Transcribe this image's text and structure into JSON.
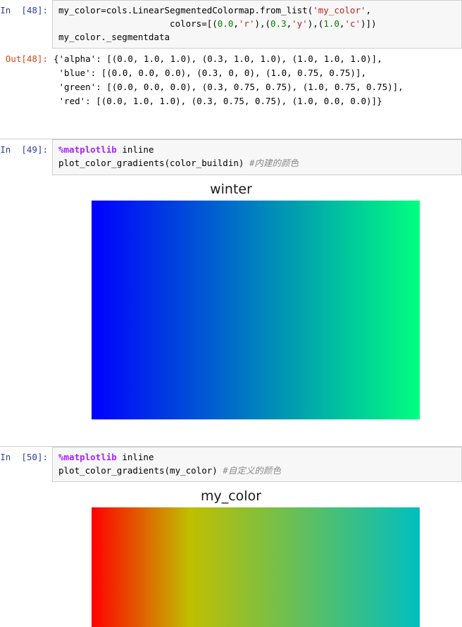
{
  "notebook": {
    "cells": [
      {
        "type": "code-input",
        "prompt": "In  [48]:",
        "lines": [
          [
            {
              "t": "plain",
              "v": "my_color=cols.LinearSegmentedColormap.from_list("
            },
            {
              "t": "str",
              "v": "'my_color'"
            },
            {
              "t": "plain",
              "v": ","
            }
          ],
          [
            {
              "t": "plain",
              "v": "                     colors=[("
            },
            {
              "t": "num",
              "v": "0.0"
            },
            {
              "t": "plain",
              "v": ","
            },
            {
              "t": "str",
              "v": "'r'"
            },
            {
              "t": "plain",
              "v": "),("
            },
            {
              "t": "num",
              "v": "0.3"
            },
            {
              "t": "plain",
              "v": ","
            },
            {
              "t": "str",
              "v": "'y'"
            },
            {
              "t": "plain",
              "v": "),("
            },
            {
              "t": "num",
              "v": "1.0"
            },
            {
              "t": "plain",
              "v": ","
            },
            {
              "t": "str",
              "v": "'c'"
            },
            {
              "t": "plain",
              "v": ")])"
            }
          ],
          [
            {
              "t": "plain",
              "v": "my_color._segmentdata"
            }
          ]
        ]
      },
      {
        "type": "text-output",
        "prompt": "Out[48]:",
        "lines": [
          "{'alpha': [(0.0, 1.0, 1.0), (0.3, 1.0, 1.0), (1.0, 1.0, 1.0)],",
          " 'blue': [(0.0, 0.0, 0.0), (0.3, 0, 0), (1.0, 0.75, 0.75)],",
          " 'green': [(0.0, 0.0, 0.0), (0.3, 0.75, 0.75), (1.0, 0.75, 0.75)],",
          " 'red': [(0.0, 1.0, 1.0), (0.3, 0.75, 0.75), (1.0, 0.0, 0.0)]}"
        ]
      },
      {
        "type": "code-input",
        "prompt": "In  [49]:",
        "lines": [
          [
            {
              "t": "magic",
              "v": "%matplotlib"
            },
            {
              "t": "plain",
              "v": " inline"
            }
          ],
          [
            {
              "t": "plain",
              "v": "plot_color_gradients(color_buildin) "
            },
            {
              "t": "cmt",
              "v": "#内建的颜色"
            }
          ]
        ]
      },
      {
        "type": "figure",
        "title": "winter",
        "size": "tall"
      },
      {
        "type": "code-input",
        "prompt": "In  [50]:",
        "lines": [
          [
            {
              "t": "magic",
              "v": "%matplotlib"
            },
            {
              "t": "plain",
              "v": " inline"
            }
          ],
          [
            {
              "t": "plain",
              "v": "plot_color_gradients(my_color) "
            },
            {
              "t": "cmt",
              "v": "#自定义的颜色"
            }
          ]
        ]
      },
      {
        "type": "figure",
        "title": "my_color",
        "size": "short"
      }
    ]
  },
  "chart_data": [
    {
      "type": "heatmap",
      "title": "winter",
      "colormap_name": "winter",
      "description": "Horizontal colormap gradient strip for the built-in matplotlib 'winter' colormap",
      "x": [
        0.0,
        1.0
      ],
      "xlabel": "",
      "ylabel": "",
      "grid": false,
      "legend": "none",
      "stops": [
        {
          "position": 0.0,
          "color": "#0000FF",
          "rgb": [
            0.0,
            0.0,
            1.0
          ]
        },
        {
          "position": 0.5,
          "color": "#0080BF",
          "rgb": [
            0.0,
            0.5,
            0.75
          ]
        },
        {
          "position": 1.0,
          "color": "#00FF80",
          "rgb": [
            0.0,
            1.0,
            0.5
          ]
        }
      ]
    },
    {
      "type": "heatmap",
      "title": "my_color",
      "colormap_name": "my_color",
      "description": "Horizontal colormap gradient strip for the user-defined LinearSegmentedColormap built from r at 0.0, y at 0.3, c at 1.0",
      "x": [
        0.0,
        1.0
      ],
      "xlabel": "",
      "ylabel": "",
      "grid": false,
      "legend": "none",
      "stops": [
        {
          "position": 0.0,
          "color": "#FF0000",
          "rgb": [
            1.0,
            0.0,
            0.0
          ]
        },
        {
          "position": 0.3,
          "color": "#BFBF00",
          "rgb": [
            0.75,
            0.75,
            0.0
          ]
        },
        {
          "position": 1.0,
          "color": "#00BFBF",
          "rgb": [
            0.0,
            0.75,
            0.75
          ]
        }
      ]
    }
  ],
  "colors": {
    "prompt_in": "#303f9f",
    "prompt_out": "#d84315",
    "string_token": "#ba2121",
    "number_token": "#008000",
    "magic_token": "#aa22ff",
    "comment_token": "#8a8a8a",
    "input_bg": "#f7f7f7",
    "input_border": "#cfcfcf"
  }
}
